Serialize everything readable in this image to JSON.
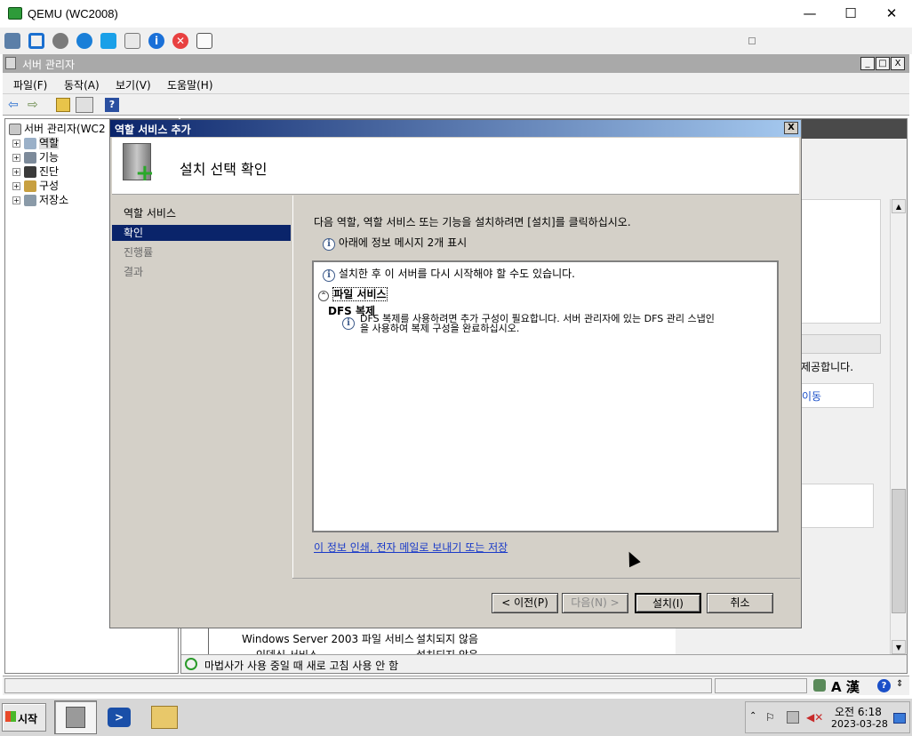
{
  "qemu": {
    "title": "QEMU (WC2008)",
    "minimize": "—",
    "maximize": "☐",
    "close": "✕",
    "toolbar_input_value": ""
  },
  "server_manager": {
    "title": "서버 관리자",
    "window_buttons": [
      "_",
      "□",
      "X"
    ],
    "menu": [
      "파일(F)",
      "동작(A)",
      "보기(V)",
      "도움말(H)"
    ],
    "tree": {
      "root": "서버 관리자(WC2",
      "items": [
        "역할",
        "기능",
        "진단",
        "구성",
        "저장소"
      ]
    },
    "right": {
      "text1": "제공합니다.",
      "text2": "이동",
      "table_row1_name": "Windows Server 2003 파일 서비스",
      "table_row1_state": "설치되지 않음",
      "table_row2_name": "인덱싱 서비스",
      "table_row2_state": "설치되지 않음",
      "refresh_status": "마법사가 사용 중일 때 새로 고침 사용 안 함"
    }
  },
  "dialog": {
    "title": "역할 서비스 추가",
    "close": "X",
    "heading": "설치 선택 확인",
    "steps": [
      "역할 서비스",
      "확인",
      "진행률",
      "결과"
    ],
    "selected_step": 1,
    "intro": "다음 역할, 역할 서비스 또는 기능을 설치하려면 [설치]를 클릭하십시오.",
    "info_count": "아래에 정보 메시지 2개 표시",
    "restart_notice": "설치한 후 이 서버를 다시 시작해야 할 수도 있습니다.",
    "section": "파일 서비스",
    "item_title": "DFS 복제",
    "item_desc_1": "DFS 복제를 사용하려면 추가 구성이 필요합니다. 서버 관리자에 있는 DFS 관리 스냅인",
    "item_desc_2": "을 사용하여 복제 구성을 완료하십시오.",
    "link": "이 정보 인쇄, 전자 메일로 보내기 또는 저장",
    "buttons": {
      "back": "< 이전(P)",
      "next": "다음(N) >",
      "install": "설치(I)",
      "cancel": "취소"
    }
  },
  "taskbar": {
    "start": "시작",
    "time": "오전 6:18",
    "date": "2023-03-28",
    "ime": "A 漢"
  }
}
